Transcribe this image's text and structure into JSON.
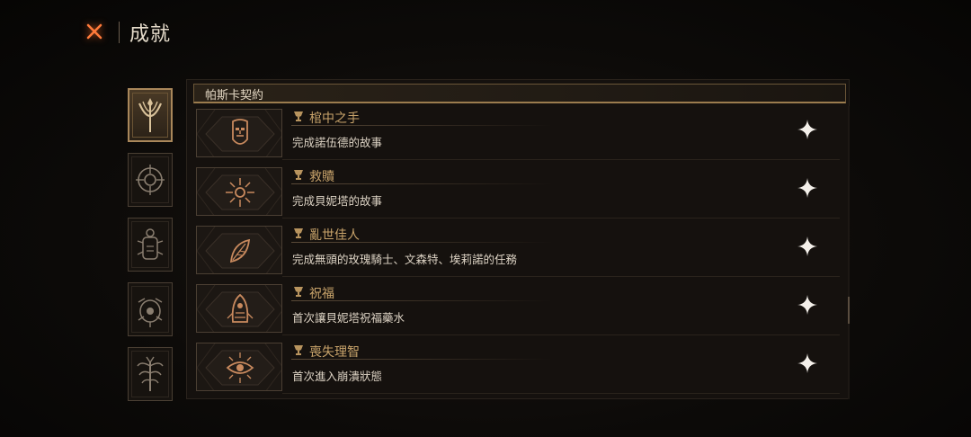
{
  "header": {
    "title": "成就",
    "close_icon": "close-x-icon"
  },
  "sidebar": {
    "tabs": [
      {
        "icon": "crescent-spear-icon",
        "active": true
      },
      {
        "icon": "crosshair-ring-icon",
        "active": false
      },
      {
        "icon": "scarab-icon",
        "active": false
      },
      {
        "icon": "eye-sigil-icon",
        "active": false
      },
      {
        "icon": "thorn-tree-icon",
        "active": false
      }
    ]
  },
  "section": {
    "title": "帕斯卡契約"
  },
  "achievements": [
    {
      "name": "棺中之手",
      "desc": "完成諾伍德的故事",
      "icon": "mask-icon",
      "status_icon": "sparkle-star-icon"
    },
    {
      "name": "救贖",
      "desc": "完成貝妮塔的故事",
      "icon": "sun-burst-icon",
      "status_icon": "sparkle-star-icon"
    },
    {
      "name": "亂世佳人",
      "desc": "完成無頭的玫瑰騎士、文森特、埃莉諾的任務",
      "icon": "leaf-icon",
      "status_icon": "sparkle-star-icon"
    },
    {
      "name": "祝福",
      "desc": "首次讓貝妮塔祝福藥水",
      "icon": "hooded-figure-icon",
      "status_icon": "sparkle-star-icon"
    },
    {
      "name": "喪失理智",
      "desc": "首次進入崩潰狀態",
      "icon": "eye-burst-icon",
      "status_icon": "sparkle-star-icon"
    }
  ],
  "colors": {
    "background": "#0b0908",
    "accent_gold": "#c9a46b",
    "close_orange": "#e0602a",
    "text_light": "#ddd3c4"
  }
}
